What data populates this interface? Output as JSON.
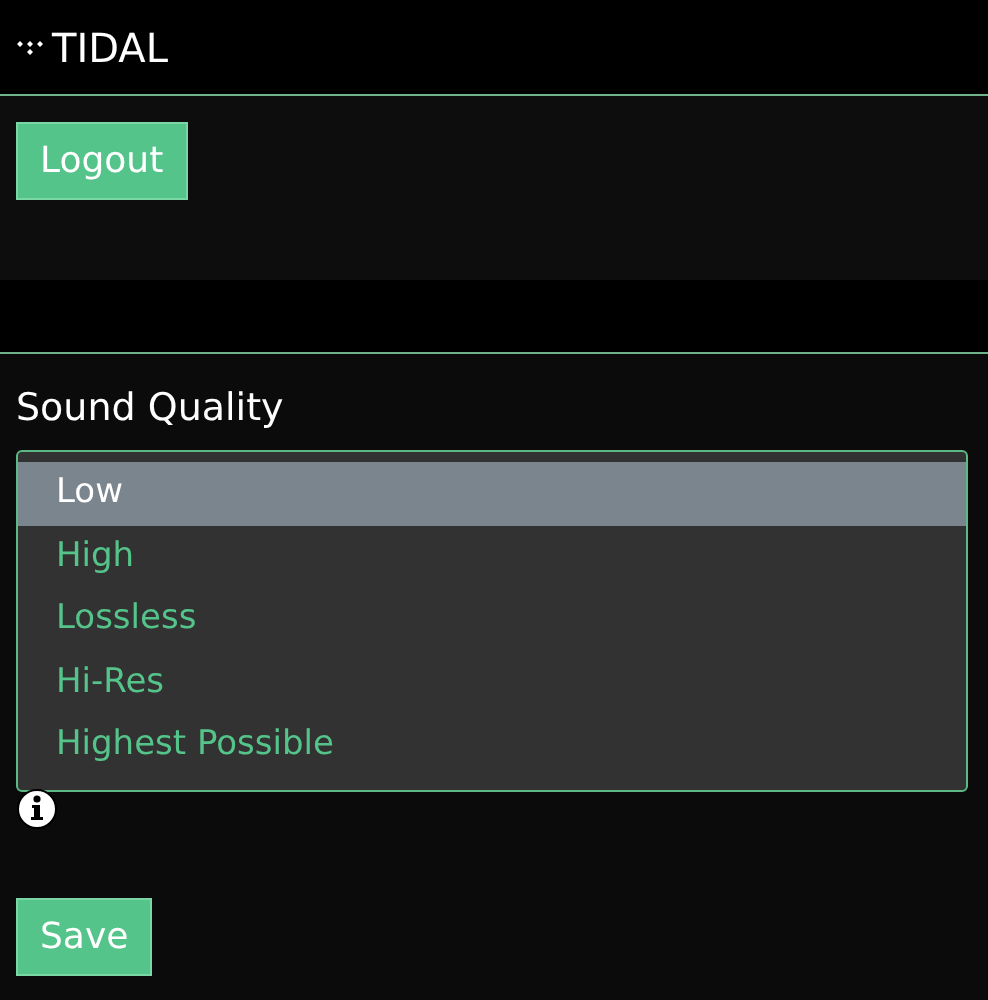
{
  "header": {
    "title": "TIDAL"
  },
  "account": {
    "logout_button": "Logout"
  },
  "sound_quality": {
    "label": "Sound Quality",
    "options": [
      {
        "label": "Low",
        "selected": true
      },
      {
        "label": "High",
        "selected": false
      },
      {
        "label": "Lossless",
        "selected": false
      },
      {
        "label": "Hi-Res",
        "selected": false
      },
      {
        "label": "Highest Possible",
        "selected": false
      }
    ],
    "save_button": "Save"
  }
}
